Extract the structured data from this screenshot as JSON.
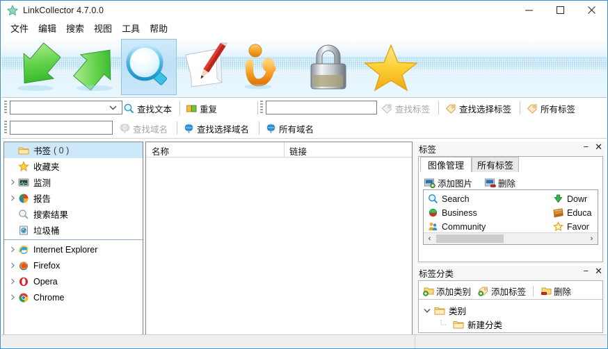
{
  "window": {
    "title": "LinkCollector 4.7.0.0",
    "icon": "star-icon",
    "controls": {
      "minimize": "minimize-icon",
      "maximize": "maximize-icon",
      "close": "close-icon"
    }
  },
  "menubar": {
    "items": [
      {
        "label": "文件",
        "name": "menu-file"
      },
      {
        "label": "编辑",
        "name": "menu-edit"
      },
      {
        "label": "搜索",
        "name": "menu-search"
      },
      {
        "label": "视图",
        "name": "menu-view"
      },
      {
        "label": "工具",
        "name": "menu-tools"
      },
      {
        "label": "帮助",
        "name": "menu-help"
      }
    ]
  },
  "toolbar": {
    "buttons": [
      {
        "name": "import-button",
        "icon": "green-arrow-down-icon",
        "selected": false
      },
      {
        "name": "export-button",
        "icon": "green-arrow-up-icon",
        "selected": false
      },
      {
        "name": "search-button",
        "icon": "magnifier-icon",
        "selected": true
      },
      {
        "name": "edit-button",
        "icon": "pencil-paper-icon",
        "selected": false
      },
      {
        "name": "check-links-button",
        "icon": "orange-check-icon",
        "selected": false,
        "has_dropdown": true
      },
      {
        "name": "password-button",
        "icon": "padlock-icon",
        "selected": false
      },
      {
        "name": "favorites-button",
        "icon": "yellow-star-icon",
        "selected": false
      }
    ]
  },
  "search": {
    "text_combo": {
      "value": "",
      "placeholder": ""
    },
    "domain_input": {
      "value": "",
      "placeholder": ""
    },
    "tag_input": {
      "value": "",
      "placeholder": ""
    },
    "buttons": [
      {
        "name": "find-text-button",
        "label": "查找文本",
        "icon": "magnifier-icon",
        "disabled": false
      },
      {
        "name": "duplicate-button",
        "label": "重复",
        "icon": "duplicate-icon",
        "disabled": false
      },
      {
        "name": "find-tag-button",
        "label": "查找标签",
        "icon": "tag-icon",
        "disabled": true
      },
      {
        "name": "find-selected-tag-button",
        "label": "查找选择标签",
        "icon": "tag-icon",
        "disabled": false
      },
      {
        "name": "all-tags-button",
        "label": "所有标签",
        "icon": "tag-icon",
        "disabled": false
      },
      {
        "name": "find-domain-button",
        "label": "查找域名",
        "icon": "globe-icon",
        "disabled": true
      },
      {
        "name": "find-selected-domain-button",
        "label": "查找选择域名",
        "icon": "globe-icon",
        "disabled": false
      },
      {
        "name": "all-domains-button",
        "label": "所有域名",
        "icon": "globe-icon",
        "disabled": false
      }
    ]
  },
  "tree": {
    "items": [
      {
        "label": "书签",
        "count": "( 0 )",
        "icon": "folder-icon",
        "selected": true,
        "expandable": false,
        "name": "tree-item-bookmarks"
      },
      {
        "label": "收藏夹",
        "count": "",
        "icon": "star-icon",
        "selected": false,
        "expandable": false,
        "name": "tree-item-favorites"
      },
      {
        "label": "监测",
        "count": "",
        "icon": "monitor-icon",
        "selected": false,
        "expandable": true,
        "name": "tree-item-monitoring"
      },
      {
        "label": "报告",
        "count": "",
        "icon": "pie-chart-icon",
        "selected": false,
        "expandable": true,
        "name": "tree-item-reports"
      },
      {
        "label": "搜索结果",
        "count": "",
        "icon": "magnifier-icon",
        "selected": false,
        "expandable": false,
        "name": "tree-item-search-results"
      },
      {
        "label": "垃圾桶",
        "count": "",
        "icon": "trash-icon",
        "selected": false,
        "expandable": false,
        "name": "tree-item-trash"
      }
    ],
    "browsers": [
      {
        "label": "Internet Explorer",
        "icon": "ie-icon",
        "expandable": true,
        "name": "tree-item-internet-explorer"
      },
      {
        "label": "Firefox",
        "icon": "firefox-icon",
        "expandable": true,
        "name": "tree-item-firefox"
      },
      {
        "label": "Opera",
        "icon": "opera-icon",
        "expandable": true,
        "name": "tree-item-opera"
      },
      {
        "label": "Chrome",
        "icon": "chrome-icon",
        "expandable": true,
        "name": "tree-item-chrome"
      }
    ]
  },
  "list": {
    "columns": [
      {
        "label": "名称",
        "name": "column-name"
      },
      {
        "label": "链接",
        "name": "column-link"
      }
    ],
    "rows": []
  },
  "tags_panel": {
    "title": "标签",
    "minimize": "−",
    "close": "✕",
    "tabs": [
      {
        "label": "图像管理",
        "active": true,
        "name": "tab-image-manage"
      },
      {
        "label": "所有标签",
        "active": false,
        "name": "tab-all-tags"
      }
    ],
    "toolbar": [
      {
        "label": "添加图片",
        "icon": "add-image-icon",
        "name": "add-image-button"
      },
      {
        "label": "删除",
        "icon": "delete-image-icon",
        "name": "delete-image-button"
      }
    ],
    "items_left": [
      {
        "label": "Search",
        "icon": "magnifier-icon"
      },
      {
        "label": "Business",
        "icon": "business-icon"
      },
      {
        "label": "Community",
        "icon": "community-icon"
      }
    ],
    "items_right": [
      {
        "label": "Dowr",
        "icon": "download-icon"
      },
      {
        "label": "Educa",
        "icon": "education-icon"
      },
      {
        "label": "Favor",
        "icon": "favorite-star-icon"
      }
    ],
    "scroll": {
      "left_arrow": "‹",
      "right_arrow": "›"
    }
  },
  "tag_categories_panel": {
    "title": "标签分类",
    "minimize": "−",
    "close": "✕",
    "toolbar": [
      {
        "label": "添加类别",
        "icon": "add-category-icon",
        "name": "add-category-button"
      },
      {
        "label": "添加标签",
        "icon": "add-tag-icon",
        "name": "add-tag-button"
      },
      {
        "label": "删除",
        "icon": "delete-category-icon",
        "name": "delete-category-button"
      }
    ],
    "tree": [
      {
        "label": "类别",
        "icon": "folder-icon",
        "level": 0,
        "expanded": true,
        "name": "category-root"
      },
      {
        "label": "新建分类",
        "icon": "folder-icon",
        "level": 1,
        "expanded": false,
        "name": "category-new"
      }
    ]
  },
  "statusbar": {
    "left": "",
    "right": ""
  }
}
